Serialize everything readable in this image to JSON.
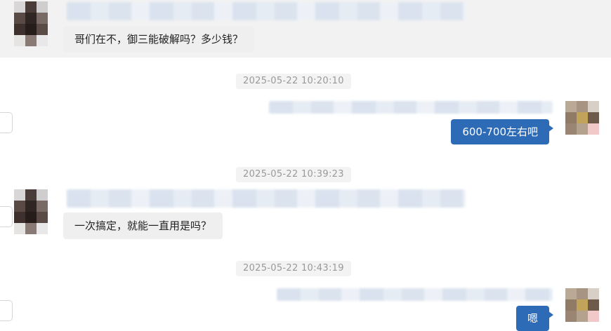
{
  "messages": [
    {
      "direction": "incoming",
      "text": "哥们在不，御三能破解吗？多少钱？"
    },
    {
      "timestamp": "2025-05-22 10:20:10"
    },
    {
      "direction": "outgoing",
      "text": "600-700左右吧"
    },
    {
      "timestamp": "2025-05-22 10:39:23"
    },
    {
      "direction": "incoming",
      "text": "一次搞定，就能一直用是吗？"
    },
    {
      "timestamp": "2025-05-22 10:43:19"
    },
    {
      "direction": "outgoing",
      "text": "嗯"
    }
  ],
  "colors": {
    "outgoing_bubble": "#2e6bb7",
    "incoming_bubble": "#efefef",
    "timestamp_text": "#999999"
  }
}
